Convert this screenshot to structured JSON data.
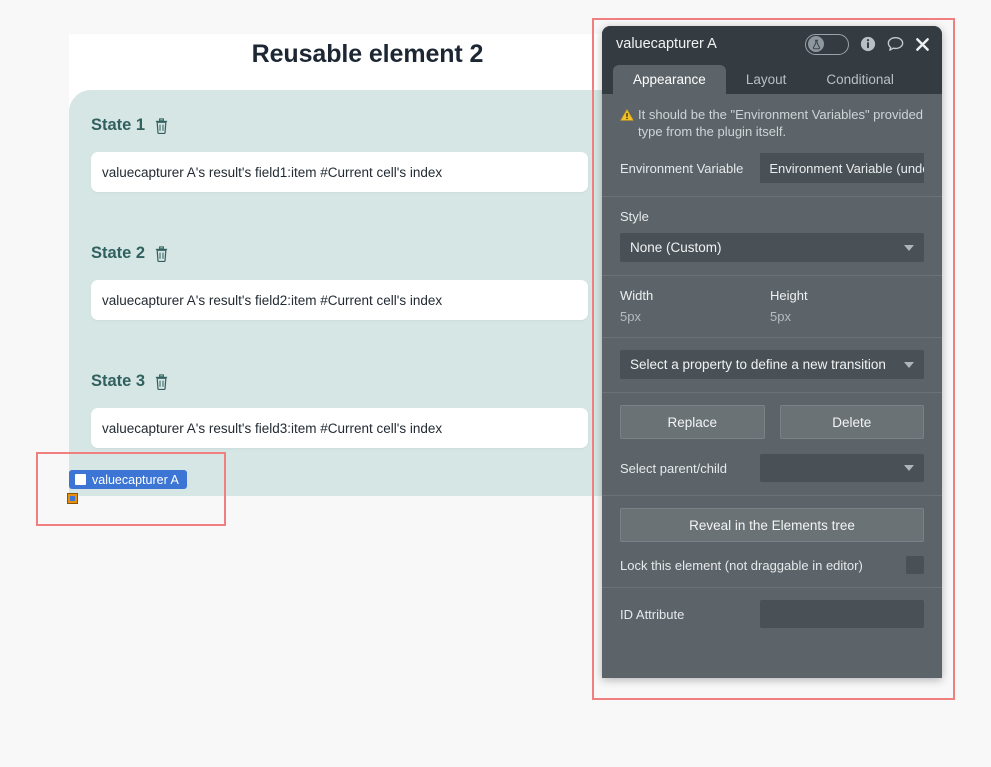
{
  "canvas": {
    "page_title": "Reusable element 2",
    "states": [
      {
        "label": "State 1",
        "delete_icon": "trash-icon",
        "value": "valuecapturer A's result's field1:item #Current cell's index"
      },
      {
        "label": "State 2",
        "delete_icon": "trash-icon",
        "value": "valuecapturer A's result's field2:item #Current cell's index"
      },
      {
        "label": "State 3",
        "delete_icon": "trash-icon",
        "value": "valuecapturer A's result's field3:item #Current cell's index"
      }
    ],
    "selected_element": {
      "tag_label": "valuecapturer A",
      "tag_icon": "element-square-icon",
      "handle_icon": "drag-handle-icon",
      "selection_color": "#f08080",
      "tag_color": "#3c75d4"
    },
    "panel_color": "#d5e6e4",
    "accent_color": "#31615f"
  },
  "editor": {
    "title": "valuecapturer A",
    "titlebar_icons": [
      {
        "name": "experimental-toggle",
        "glyph": "flask-icon"
      },
      {
        "name": "info-icon",
        "glyph": "i"
      },
      {
        "name": "comment-icon",
        "glyph": "speech-bubble"
      },
      {
        "name": "close-icon",
        "glyph": "x"
      }
    ],
    "tabs": [
      {
        "label": "Appearance",
        "active": true
      },
      {
        "label": "Layout",
        "active": false
      },
      {
        "label": "Conditional",
        "active": false
      }
    ],
    "warning": {
      "icon": "warning-triangle-icon",
      "text": "It should be the \"Environment Variables\" provided type from the plugin itself."
    },
    "environment_variable": {
      "label": "Environment Variable",
      "value": "Environment Variable (undef"
    },
    "style": {
      "label": "Style",
      "value": "None (Custom)"
    },
    "dimensions": {
      "width_label": "Width",
      "width_value": "5px",
      "height_label": "Height",
      "height_value": "5px"
    },
    "transition": {
      "value": "Select a property to define a new transition"
    },
    "buttons": {
      "replace": "Replace",
      "delete": "Delete",
      "reveal": "Reveal in the Elements tree"
    },
    "select_parent": {
      "label": "Select parent/child",
      "value": ""
    },
    "lock": {
      "label": "Lock this element (not draggable in editor)",
      "checked": false
    },
    "id_attribute": {
      "label": "ID Attribute",
      "value": ""
    },
    "panel_bg": "#5c6469",
    "titlebar_bg": "#343b41"
  }
}
